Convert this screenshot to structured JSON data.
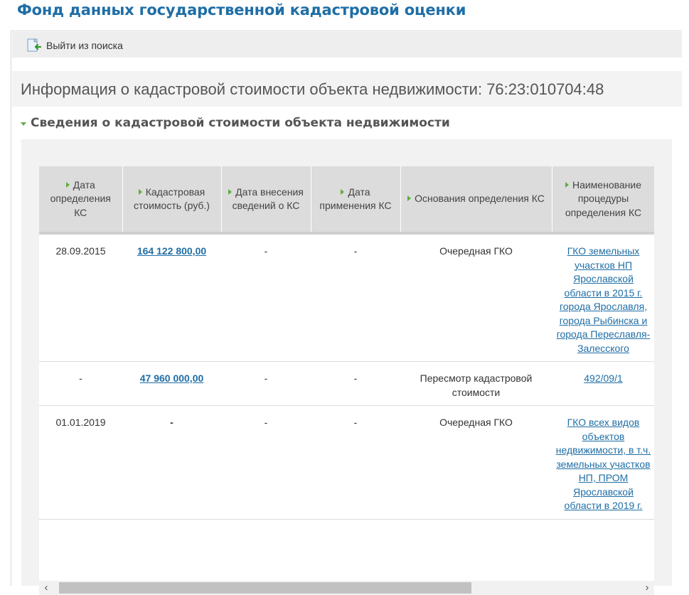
{
  "app": {
    "title": "Фонд данных государственной кадастровой оценки"
  },
  "toolbar": {
    "exit_label": "Выйти из поиска"
  },
  "info": {
    "heading": "Информация о кадастровой стоимости объекта недвижимости: 76:23:010704:48"
  },
  "section": {
    "title": "Сведения о кадастровой стоимости объекта недвижимости"
  },
  "table": {
    "headers": [
      "Дата определения КС",
      "Кадастровая стоимость (руб.)",
      "Дата внесения сведений о КС",
      "Дата применения КС",
      "Основания определения КС",
      "Наименование процедуры определения КС"
    ],
    "rows": [
      {
        "date_determined": "28.09.2015",
        "value": "164 122 800,00",
        "date_entered": "-",
        "date_applied": "-",
        "basis": "Очередная ГКО",
        "procedure": "ГКО земельных участков НП Ярославской области в 2015 г. города Ярославля, города Рыбинска и города Переславля-Залесского"
      },
      {
        "date_determined": "-",
        "value": "47 960 000,00",
        "date_entered": "-",
        "date_applied": "-",
        "basis": "Пересмотр кадастровой стоимости",
        "procedure": "492/09/1"
      },
      {
        "date_determined": "01.01.2019",
        "value": "-",
        "date_entered": "-",
        "date_applied": "-",
        "basis": "Очередная ГКО",
        "procedure": "ГКО всех видов объектов недвижимости, в т.ч. земельных участков НП, ПРОМ Ярославской области в 2019 г."
      }
    ]
  },
  "icons": {
    "exit": "exit-search-icon",
    "section_toggle": "triangle-down-icon",
    "header_sort": "triangle-right-icon",
    "scroll_left": "chevron-left-icon",
    "scroll_right": "chevron-right-icon"
  },
  "colors": {
    "title": "#1f6ea6",
    "link": "#1f6ea6",
    "accent_green": "#5fae3a"
  }
}
